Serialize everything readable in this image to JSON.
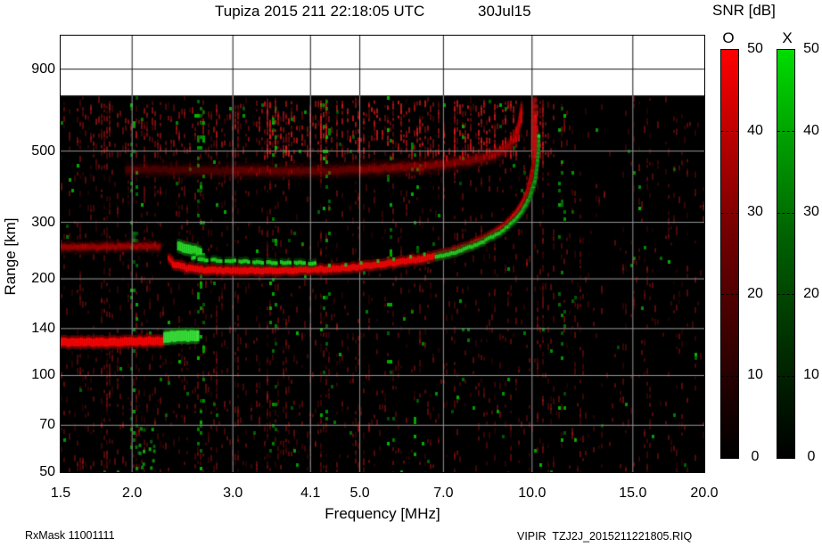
{
  "header": {
    "title": "Tupiza 2015 211 22:18:05 UTC",
    "date": "30Jul15"
  },
  "footer": {
    "left": "RxMask 11001111",
    "right": "VIPIR  TZJ2J_2015211221805.RIQ"
  },
  "colorbars": {
    "title": "SNR [dB]",
    "range": [
      0,
      50
    ],
    "tick_values": [
      50,
      40,
      30,
      20,
      10,
      0
    ],
    "dash_values": [
      40,
      30,
      20,
      10
    ],
    "bars": [
      {
        "label": "O",
        "color_top": "#ff0000"
      },
      {
        "label": "X",
        "color_top": "#00dd00"
      }
    ]
  },
  "chart_data": {
    "type": "heatmap",
    "description": "Ionogram: echo SNR (O-mode red, X-mode green) vs frequency and virtual range",
    "axes": {
      "x": {
        "label": "Frequency [MHz]",
        "scale": "log",
        "range": [
          1.5,
          20
        ],
        "tick_labels": [
          "1.5",
          "2.0",
          "3.0",
          "4.1",
          "5.0",
          "7.0",
          "10.0",
          "15.0",
          "20.0"
        ],
        "grid_ticks": [
          2.0,
          3.0,
          4.1,
          5.0,
          7.0,
          10.0,
          15.0
        ]
      },
      "y": {
        "label": "Range [km]",
        "scale": "log",
        "range": [
          50,
          1144
        ],
        "tick_values": [
          900,
          500,
          300,
          200,
          140,
          100,
          70,
          50
        ],
        "grid_ticks": [
          900,
          500,
          300,
          200,
          140,
          100,
          70
        ]
      }
    },
    "colors": {
      "plot_background": "#000000",
      "empty_top_background": "#ffffff",
      "grid_color": "#969696",
      "grid_color_on_white": "#1a1a1a",
      "o_mode": "#f20808",
      "x_mode": "#23d723"
    },
    "max_data_range_km": 745,
    "traces": {
      "e_layer_o": [
        [
          1.5,
          127
        ],
        [
          1.8,
          127
        ],
        [
          2.1,
          128
        ],
        [
          2.28,
          128
        ]
      ],
      "e_layer_x": [
        [
          2.28,
          131
        ],
        [
          2.45,
          133
        ],
        [
          2.62,
          132
        ]
      ],
      "f_layer_o": [
        [
          2.32,
          234
        ],
        [
          2.36,
          222
        ],
        [
          2.5,
          216
        ],
        [
          2.7,
          213
        ],
        [
          3.0,
          212
        ],
        [
          3.5,
          212
        ],
        [
          4.0,
          213
        ],
        [
          4.5,
          215
        ],
        [
          5.0,
          218
        ],
        [
          5.5,
          222
        ],
        [
          6.0,
          227
        ],
        [
          6.5,
          232
        ],
        [
          7.0,
          239
        ],
        [
          7.5,
          248
        ],
        [
          8.0,
          259
        ],
        [
          8.5,
          273
        ],
        [
          8.9,
          289
        ],
        [
          9.2,
          306
        ],
        [
          9.5,
          329
        ],
        [
          9.7,
          353
        ],
        [
          9.85,
          381
        ],
        [
          9.95,
          412
        ],
        [
          10.05,
          452
        ],
        [
          10.1,
          505
        ],
        [
          10.12,
          565
        ],
        [
          10.13,
          645
        ]
      ],
      "f_layer_x_low": [
        [
          2.55,
          233
        ],
        [
          2.7,
          229
        ],
        [
          3.0,
          227
        ],
        [
          3.4,
          225
        ],
        [
          3.8,
          224
        ],
        [
          4.2,
          224
        ]
      ],
      "f_layer_x_dots": [
        [
          4.4,
          216
        ],
        [
          4.7,
          217
        ],
        [
          5.0,
          220
        ],
        [
          5.35,
          223
        ],
        [
          5.7,
          226
        ],
        [
          6.1,
          230
        ],
        [
          6.45,
          234
        ]
      ],
      "f_layer_x_rise": [
        [
          6.8,
          233
        ],
        [
          7.3,
          241
        ],
        [
          7.8,
          251
        ],
        [
          8.3,
          263
        ],
        [
          8.8,
          279
        ],
        [
          9.2,
          297
        ],
        [
          9.6,
          323
        ],
        [
          9.9,
          357
        ],
        [
          10.1,
          400
        ],
        [
          10.2,
          452
        ],
        [
          10.25,
          512
        ],
        [
          10.27,
          565
        ]
      ],
      "x_start_blob": [
        [
          2.41,
          252
        ],
        [
          2.5,
          248
        ],
        [
          2.65,
          242
        ]
      ],
      "second_hop": [
        [
          1.95,
          438
        ],
        [
          2.5,
          436
        ],
        [
          3.0,
          434
        ],
        [
          3.6,
          433
        ],
        [
          4.2,
          434
        ],
        [
          5.0,
          438
        ],
        [
          6.0,
          445
        ],
        [
          6.8,
          452
        ],
        [
          7.5,
          462
        ],
        [
          8.1,
          474
        ],
        [
          8.6,
          490
        ],
        [
          9.0,
          510
        ],
        [
          9.25,
          538
        ],
        [
          9.42,
          575
        ],
        [
          9.52,
          625
        ],
        [
          9.58,
          680
        ]
      ],
      "low_freq_band": [
        [
          1.5,
          250
        ],
        [
          1.8,
          252
        ],
        [
          2.1,
          253
        ],
        [
          2.25,
          252
        ]
      ],
      "asymptote_streaks": [
        [
          [
            10.12,
            480
          ],
          [
            10.13,
            740
          ]
        ],
        [
          [
            10.0,
            500
          ],
          [
            10.02,
            735
          ]
        ]
      ]
    },
    "texture": {
      "seed": 42,
      "red_noise_density": 0.1,
      "green_noise_density": 0.005,
      "clouds": [
        {
          "f": [
            3.3,
            9.6
          ],
          "range_km": [
            480,
            740
          ],
          "density": 0.42,
          "alpha": 0.55
        },
        {
          "f": [
            1.6,
            3.3
          ],
          "range_km": [
            500,
            720
          ],
          "density": 0.2,
          "alpha": 0.32
        },
        {
          "f": [
            9.9,
            10.6
          ],
          "range_km": [
            460,
            735
          ],
          "density": 0.26,
          "alpha": 0.42
        },
        {
          "f": [
            10.6,
            11.7
          ],
          "range_km": [
            500,
            740
          ],
          "density": 0.16,
          "alpha": 0.3
        }
      ],
      "green_columns": [
        {
          "f": 2.0,
          "strength": 6
        },
        {
          "f": 2.63,
          "strength": 9
        },
        {
          "f": 3.5,
          "strength": 7
        },
        {
          "f": 4.35,
          "strength": 5
        },
        {
          "f": 5.6,
          "strength": 6
        },
        {
          "f": 6.2,
          "strength": 4
        },
        {
          "f": 7.5,
          "strength": 3
        },
        {
          "f": 11.2,
          "strength": 5
        }
      ],
      "dark_bands": [
        {
          "f": [
            13.2,
            14.1
          ]
        }
      ],
      "shadow_regions": [
        {
          "f": [
            10.3,
            12.9
          ],
          "range_km": [
            290,
            745
          ],
          "factor": 0.35
        }
      ],
      "green_cluster": {
        "f": [
          2.02,
          2.2
        ],
        "range_km": [
          52,
          70
        ],
        "count": 16
      }
    }
  }
}
